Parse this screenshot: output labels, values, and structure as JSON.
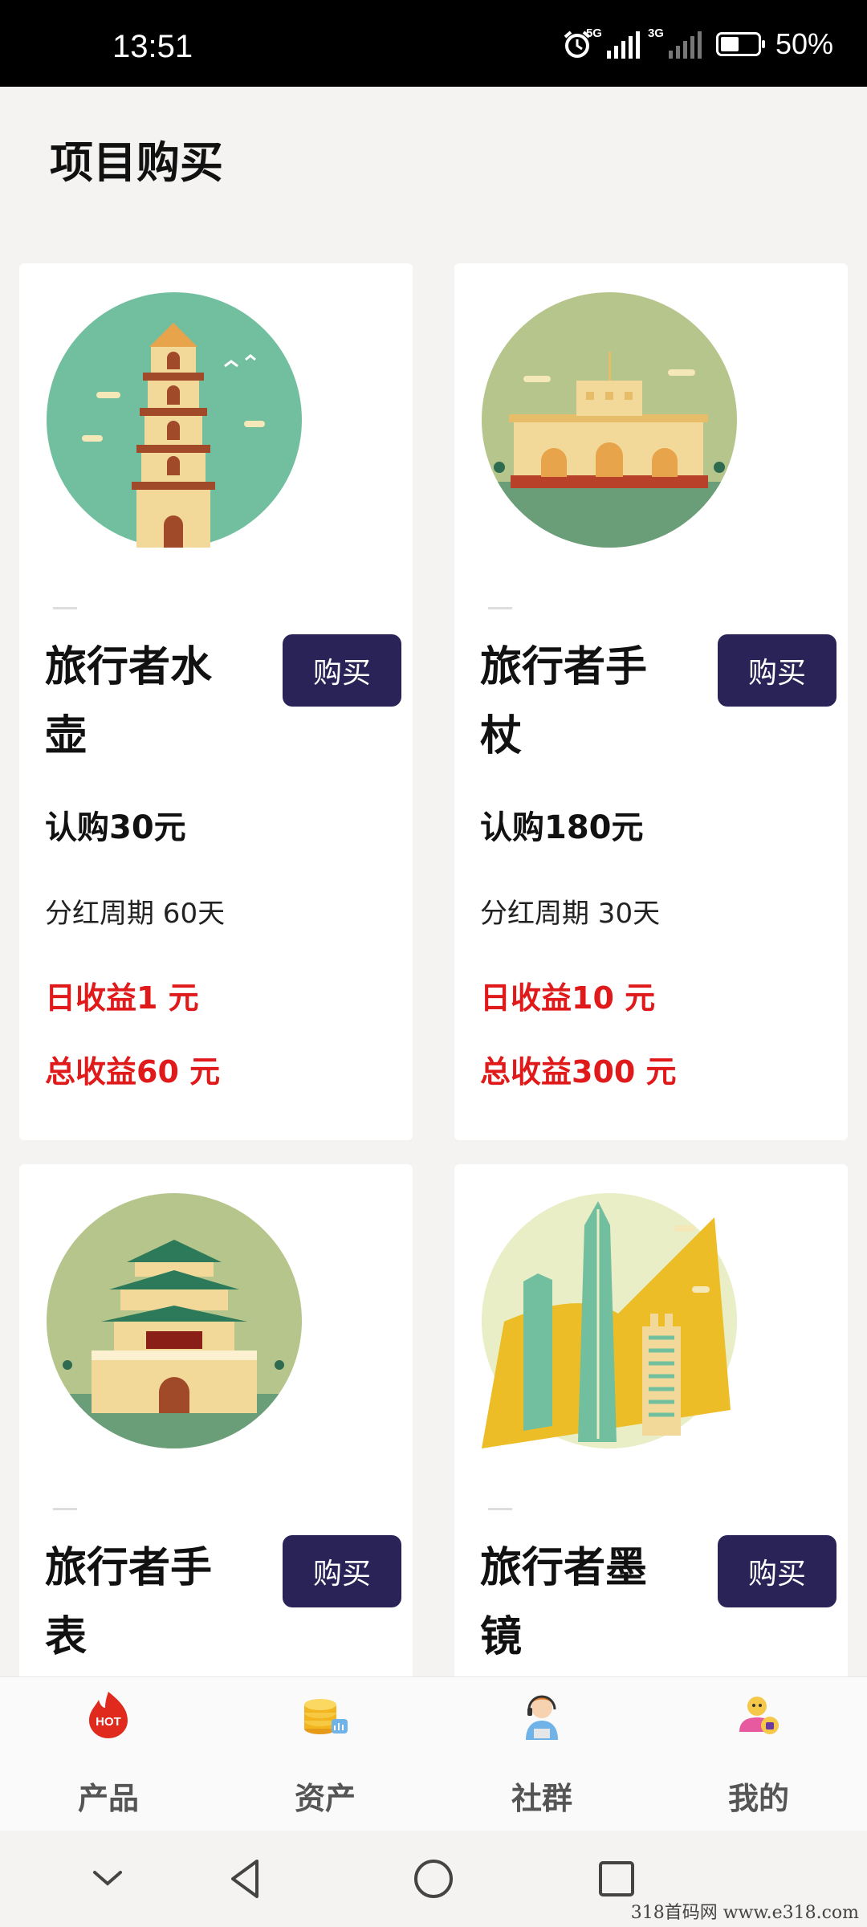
{
  "status": {
    "time": "13:51",
    "net1": "5G",
    "net2": "3G",
    "battery": "50%",
    "battery_level": 0.5
  },
  "page": {
    "title": "项目购买"
  },
  "products": [
    {
      "name": "旅行者水壶",
      "buy_label": "购买",
      "price": "认购30元",
      "cycle": "分红周期 60天",
      "daily": "日收益1 元",
      "total": "总收益60 元",
      "icon": "pagoda-illustration"
    },
    {
      "name": "旅行者手杖",
      "buy_label": "购买",
      "price": "认购180元",
      "cycle": "分红周期 30天",
      "daily": "日收益10 元",
      "total": "总收益300 元",
      "icon": "palace-illustration"
    },
    {
      "name": "旅行者手表",
      "buy_label": "购买",
      "icon": "gate-tower-illustration"
    },
    {
      "name": "旅行者墨镜",
      "buy_label": "购买",
      "icon": "skyscraper-illustration"
    }
  ],
  "tabs": [
    {
      "label": "产品",
      "icon": "hot-icon",
      "badge": "HOT"
    },
    {
      "label": "资产",
      "icon": "coins-icon"
    },
    {
      "label": "社群",
      "icon": "support-agent-icon"
    },
    {
      "label": "我的",
      "icon": "user-profile-icon"
    }
  ],
  "watermark": "318首码网  www.e318.com"
}
